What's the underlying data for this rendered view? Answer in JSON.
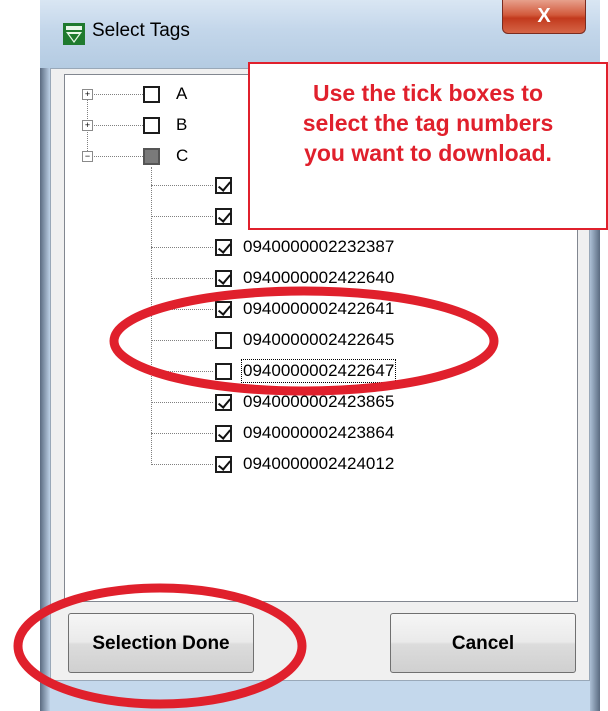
{
  "window": {
    "title": "Select Tags",
    "close_glyph": "X"
  },
  "tree": {
    "root_nodes": [
      {
        "label": "A",
        "expanded": false,
        "state": "unchecked"
      },
      {
        "label": "B",
        "expanded": false,
        "state": "unchecked"
      },
      {
        "label": "C",
        "expanded": true,
        "state": "partial"
      }
    ],
    "children_of_C": [
      {
        "label": "",
        "checked": true
      },
      {
        "label": "",
        "checked": true
      },
      {
        "label": "0940000002232387",
        "checked": true
      },
      {
        "label": "0940000002422640",
        "checked": true
      },
      {
        "label": "0940000002422641",
        "checked": true
      },
      {
        "label": "0940000002422645",
        "checked": false
      },
      {
        "label": "0940000002422647",
        "checked": false,
        "focused": true
      },
      {
        "label": "0940000002423865",
        "checked": true
      },
      {
        "label": "0940000002423864",
        "checked": true
      },
      {
        "label": "0940000002424012",
        "checked": true
      }
    ]
  },
  "callout": {
    "lines": [
      "Use the tick boxes to",
      "select the tag numbers",
      "you want to download."
    ],
    "color": "#e0202c"
  },
  "buttons": {
    "selection_done": "Selection Done",
    "cancel": "Cancel"
  },
  "icons": {
    "app_icon": "tag-reader-icon",
    "close": "close-icon"
  },
  "annotation_color": "#e0202c"
}
